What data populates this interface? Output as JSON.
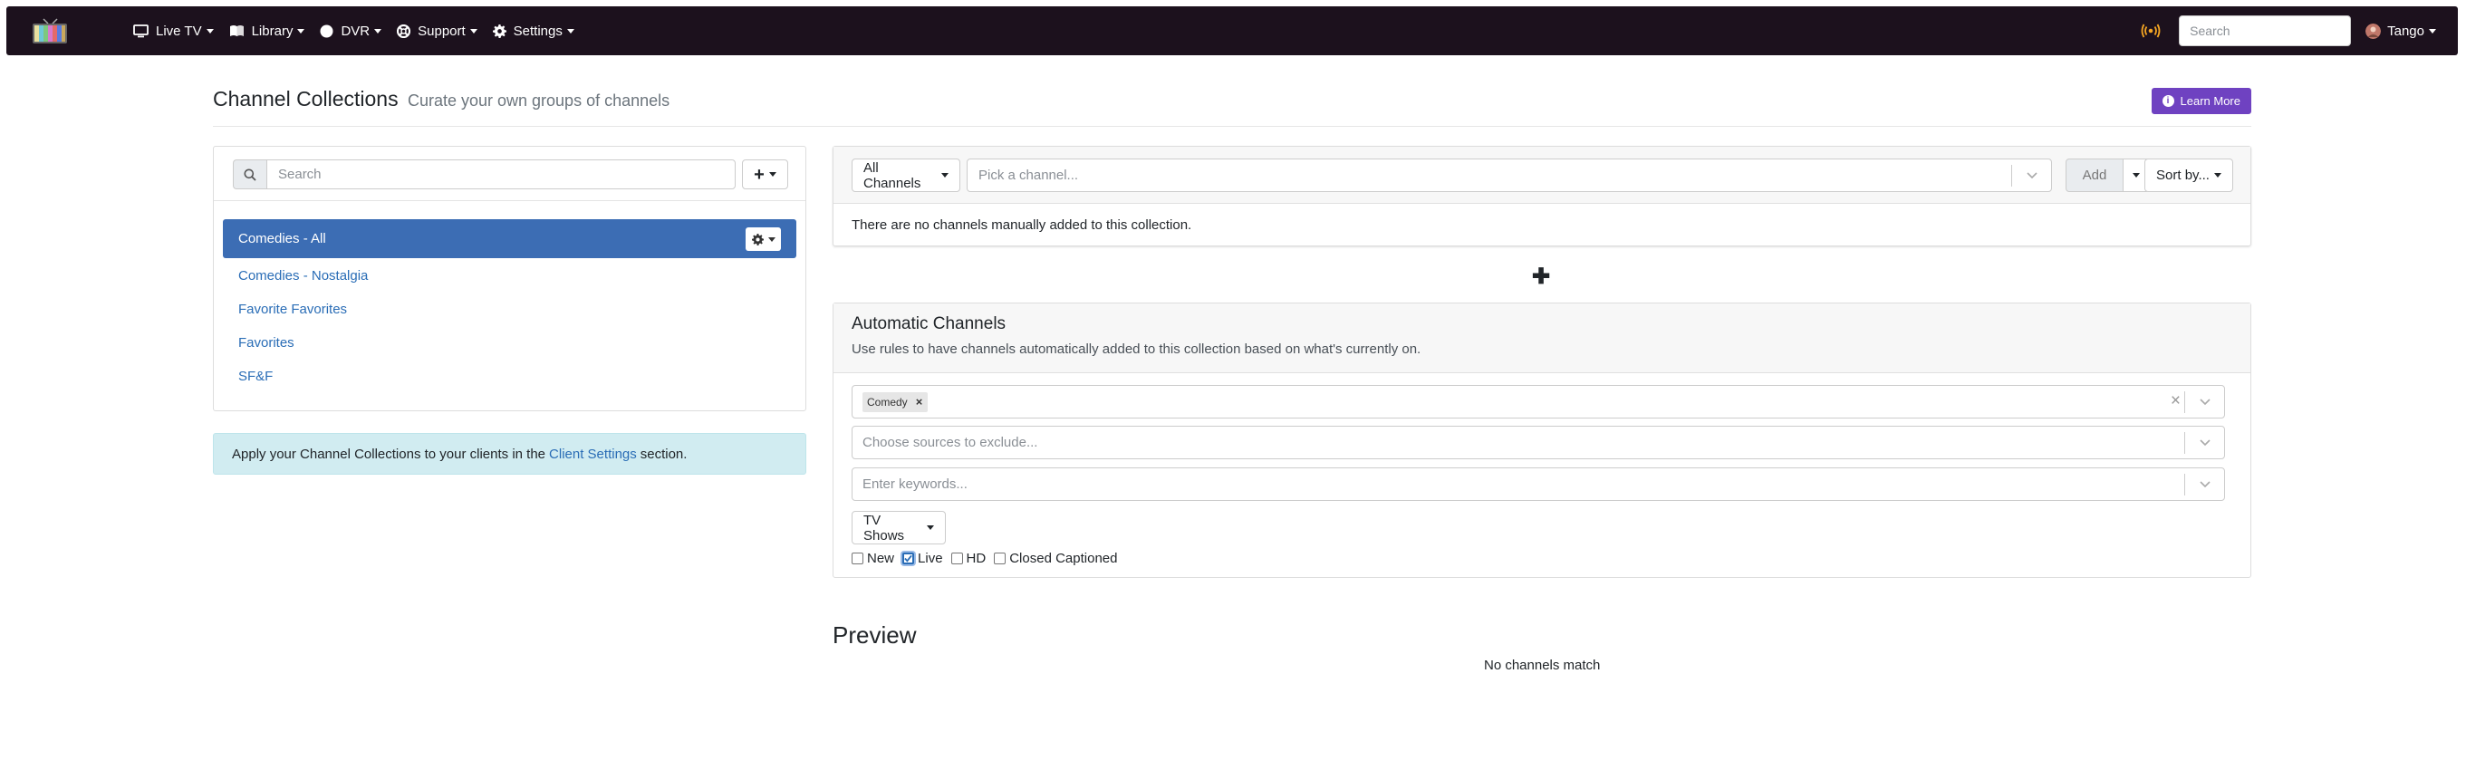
{
  "nav": {
    "logo": "channels-logo",
    "items": [
      {
        "label": "Live TV",
        "icon": "tv-icon"
      },
      {
        "label": "Library",
        "icon": "book-icon"
      },
      {
        "label": "DVR",
        "icon": "record-icon"
      },
      {
        "label": "Support",
        "icon": "lifebuoy-icon"
      },
      {
        "label": "Settings",
        "icon": "gear-icon"
      }
    ],
    "broadcast_icon": "broadcast-icon",
    "broadcast_color": "#f5a623",
    "search_placeholder": "Search",
    "user": "Tango"
  },
  "header": {
    "title": "Channel Collections",
    "subtitle": "Curate your own groups of channels",
    "learn_more": "Learn More",
    "learn_color": "#6f42c1"
  },
  "left": {
    "search_placeholder": "Search",
    "collections": [
      {
        "label": "Comedies - All",
        "active": true
      },
      {
        "label": "Comedies - Nostalgia",
        "active": false
      },
      {
        "label": "Favorite Favorites",
        "active": false
      },
      {
        "label": "Favorites",
        "active": false
      },
      {
        "label": "SF&F",
        "active": false
      }
    ],
    "active_color": "#3c6db4",
    "note_prefix": "Apply your Channel Collections to your clients in the",
    "note_link": "Client Settings",
    "note_suffix": "section."
  },
  "manual": {
    "source": "All Channels",
    "pick_placeholder": "Pick a channel...",
    "add_label": "Add",
    "sort_label": "Sort by...",
    "empty_text": "There are no channels manually added to this collection."
  },
  "automatic": {
    "title": "Automatic Channels",
    "subtitle": "Use rules to have channels automatically added to this collection based on what's currently on.",
    "genre_tag": "Comedy",
    "exclude_placeholder": "Choose sources to exclude...",
    "keywords_placeholder": "Enter keywords...",
    "content_type": "TV Shows",
    "filters": [
      {
        "label": "New",
        "checked": false
      },
      {
        "label": "Live",
        "checked": true
      },
      {
        "label": "HD",
        "checked": false
      },
      {
        "label": "Closed Captioned",
        "checked": false
      }
    ]
  },
  "preview": {
    "title": "Preview",
    "empty_text": "No channels match"
  }
}
